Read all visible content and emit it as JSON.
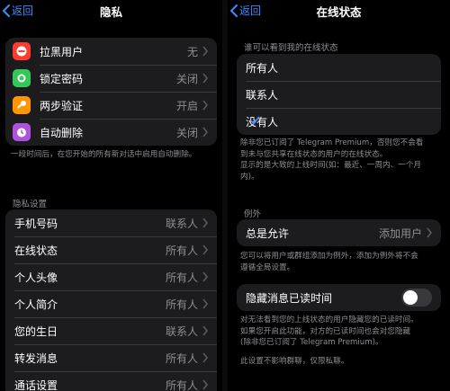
{
  "left": {
    "back_label": "返回",
    "title": "隐私",
    "security_rows": [
      {
        "label": "拉黑用户",
        "value": "无",
        "icon": "block-icon",
        "color": "#ff3b30"
      },
      {
        "label": "锁定密码",
        "value": "关闭",
        "icon": "passcode-icon",
        "color": "#34c759"
      },
      {
        "label": "两步验证",
        "value": "开启",
        "icon": "key-icon",
        "color": "#ff9500"
      },
      {
        "label": "自动删除",
        "value": "关闭",
        "icon": "timer-icon",
        "color": "#af52de"
      }
    ],
    "auto_delete_note": "一段时间后，在您开始的所有新对话中启用自动删除。",
    "privacy_header": "隐私设置",
    "privacy_rows": [
      {
        "label": "手机号码",
        "value": "联系人"
      },
      {
        "label": "在线状态",
        "value": "所有人"
      },
      {
        "label": "个人头像",
        "value": "所有人"
      },
      {
        "label": "个人简介",
        "value": "所有人"
      },
      {
        "label": "您的生日",
        "value": "联系人"
      },
      {
        "label": "转发消息",
        "value": "所有人"
      },
      {
        "label": "通话设置",
        "value": "所有人"
      }
    ]
  },
  "right": {
    "back_label": "返回",
    "title": "在线状态",
    "header": "谁可以看到我的在线状态",
    "options": [
      {
        "label": "所有人",
        "selected": false
      },
      {
        "label": "联系人",
        "selected": false
      },
      {
        "label": "没有人",
        "selected": true
      }
    ],
    "note_lines": [
      "除非您已订阅了 Telegram Premium，否则您不会看",
      "到未与您共享在线状态的用户的在线状态。",
      "显示的是大致的上线时间(如：最近、一周内、一个月",
      "内)。"
    ],
    "exceptions_header": "例外",
    "always_allow": {
      "label": "总是允许",
      "value": "添加用户"
    },
    "exceptions_note_lines": [
      "您可以将用户或群组添加为例外，添加为例外将不会",
      "遵循全局设置。"
    ],
    "hide_read": {
      "label": "隐藏消息已读时间",
      "on": false
    },
    "hide_read_note_lines": [
      "对无法看到您的上线状态的用户隐藏您的已读时间。",
      "如果您开启此功能，对方的已读时间也会对您隐藏",
      "(除非您已订阅了 Telegram Premium)。"
    ],
    "hide_read_note2": "此设置不影响群聊，仅限私聊。"
  },
  "colors": {
    "accent": "#3e8bff",
    "background": "#000000",
    "cell": "#1c1c1e",
    "secondary_text": "#8e8e93"
  }
}
